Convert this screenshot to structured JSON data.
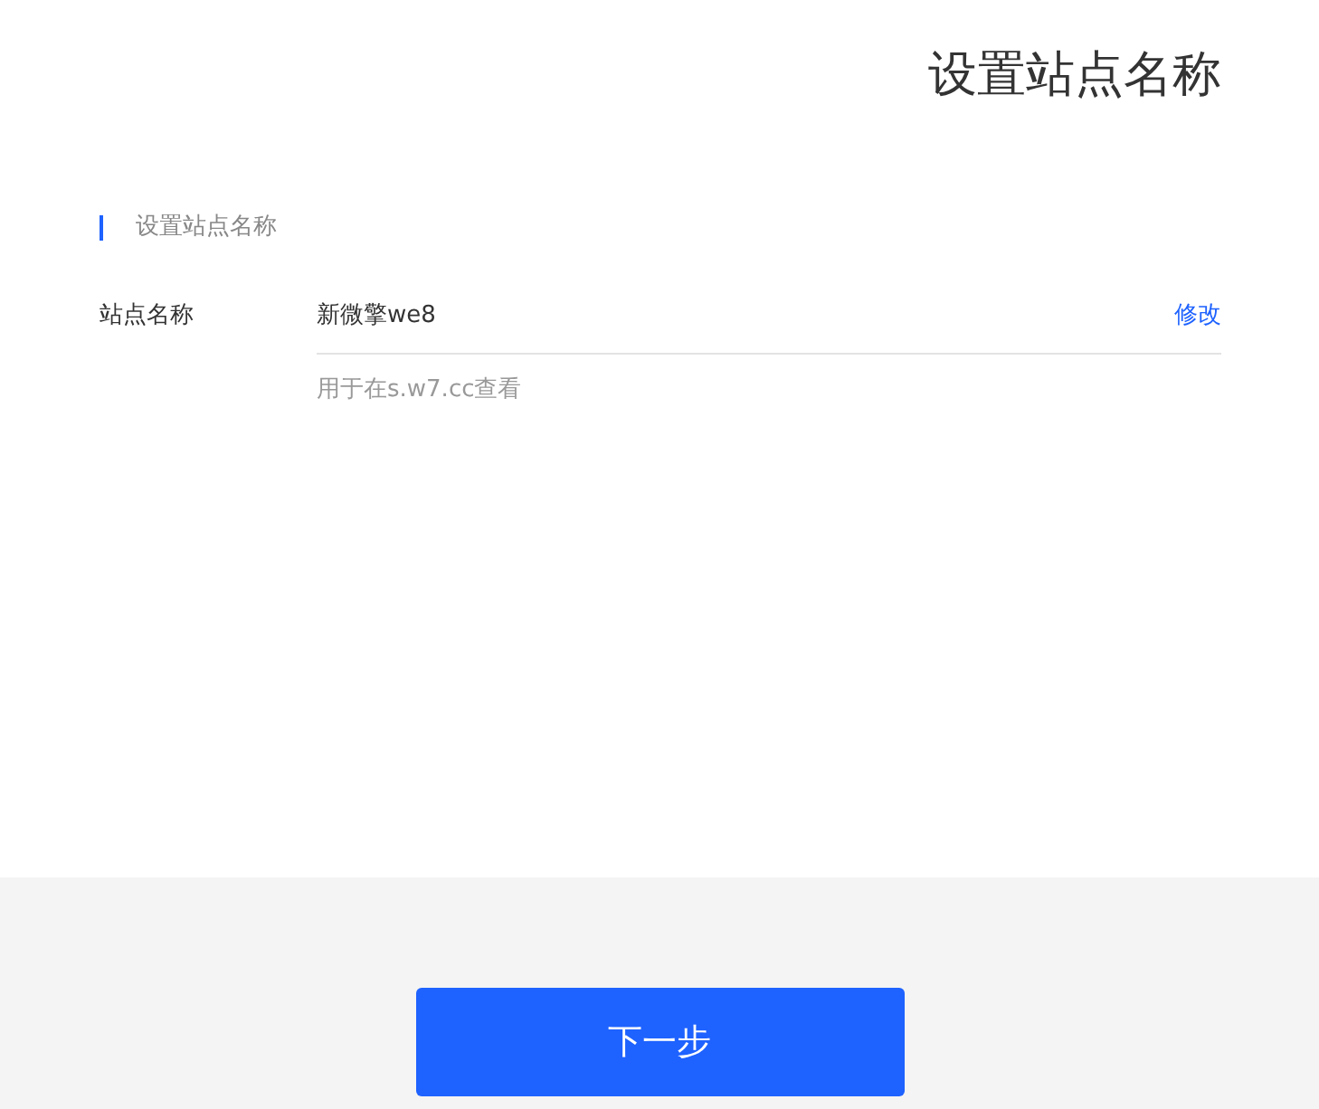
{
  "page_title": "设置站点名称",
  "section": {
    "title": "设置站点名称"
  },
  "field": {
    "label": "站点名称",
    "value": "新微擎we8",
    "action": "修改",
    "hint": "用于在s.w7.cc查看"
  },
  "footer": {
    "button": "下一步"
  }
}
